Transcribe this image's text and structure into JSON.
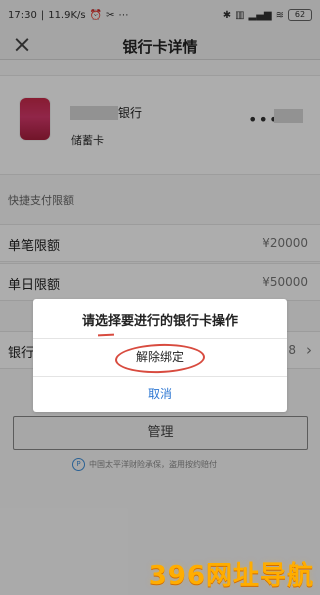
{
  "status_bar": {
    "time": "17:30",
    "network_speed": "11.9K/s",
    "battery": "62"
  },
  "header": {
    "title": "银行卡详情"
  },
  "card": {
    "bank_name": "银行",
    "card_type": "储蓄卡",
    "dots": "••••"
  },
  "limits": {
    "section_title": "快捷支付限额",
    "rows": [
      {
        "label": "单笔限额",
        "value": "¥20000"
      },
      {
        "label": "单日限额",
        "value": "¥50000"
      },
      {
        "label": "银行",
        "value": "8"
      }
    ]
  },
  "manage_button": {
    "label": "管理"
  },
  "insurance": {
    "text": "中国太平洋财险承保，盗用按约赔付"
  },
  "dialog": {
    "title": "请选择要进行的银行卡操作",
    "unbind": "解除绑定",
    "cancel": "取消"
  },
  "watermark": {
    "text": "396网址导航"
  },
  "colors": {
    "accent": "#2f78d3",
    "annotation": "#d84b3f",
    "watermark": "#ffad00"
  }
}
